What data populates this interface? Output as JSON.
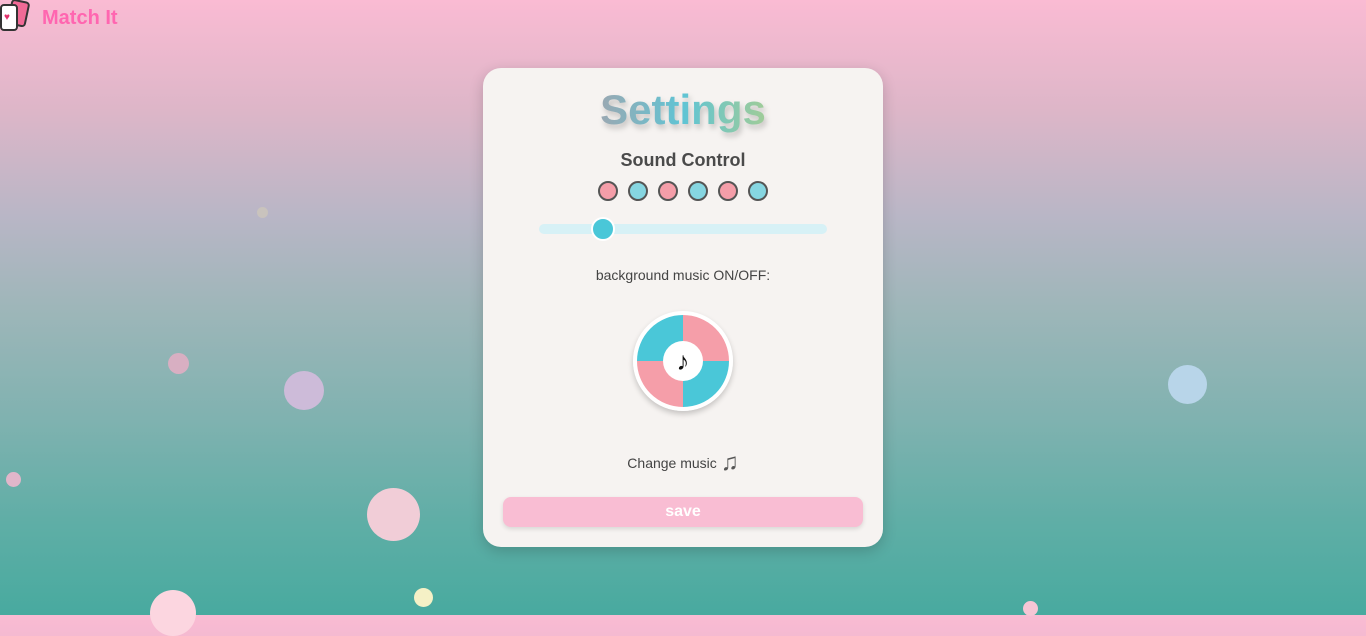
{
  "app": {
    "title": "Match It",
    "logo_icon": "playing-cards-icon"
  },
  "settings": {
    "title": "Settings",
    "sound_section": "Sound Control",
    "volume_dots": [
      "#f59ea9",
      "#86d6e1",
      "#f59ea9",
      "#86d6e1",
      "#f59ea9",
      "#86d6e1"
    ],
    "volume_percent": 20,
    "bg_music_label": "background music ON/OFF:",
    "music_toggle_icon": "♪",
    "change_music_label": "Change music",
    "change_music_icon": "♫",
    "save_label": "save"
  },
  "colors": {
    "pink": "#f59ea9",
    "cyan": "#4ac7d8",
    "brand": "#ff66b0",
    "save": "#f9bdd3"
  }
}
